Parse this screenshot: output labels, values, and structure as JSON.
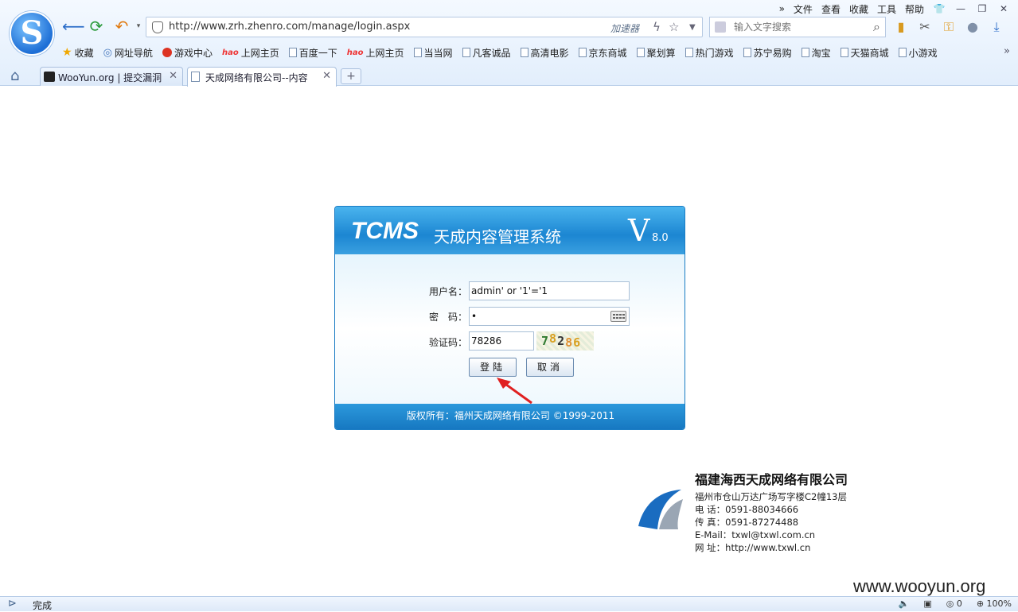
{
  "browser": {
    "menu": [
      "文件",
      "查看",
      "收藏",
      "工具",
      "帮助"
    ],
    "address_url": "http://www.zrh.zhenro.com/manage/login.aspx",
    "accelerator_label": "加速器",
    "search_placeholder": "输入文字搜索",
    "bookmarks": [
      "收藏",
      "网址导航",
      "游戏中心",
      "上网主页",
      "百度一下",
      "上网主页",
      "当当网",
      "凡客诚品",
      "高清电影",
      "京东商城",
      "聚划算",
      "热门游戏",
      "苏宁易购",
      "淘宝",
      "天猫商城",
      "小游戏"
    ],
    "tabs": [
      {
        "label": "WooYun.org | 提交漏洞"
      },
      {
        "label": "天成网络有限公司--内容"
      }
    ]
  },
  "login": {
    "brand": "TCMS",
    "system_name": "天成内容管理系统",
    "version_letter": "V",
    "version_number": "8.0",
    "username_label": "用户名：",
    "username_value": "admin' or '1'='1",
    "password_label": "密　码：",
    "password_value": "•",
    "captcha_label": "验证码：",
    "captcha_value": "78286",
    "captcha_digits": [
      "7",
      "8",
      "2",
      "8",
      "6"
    ],
    "login_button": "登陆",
    "cancel_button": "取消",
    "copyright": "版权所有：福州天成网络有限公司  ©1999-2011"
  },
  "company": {
    "name": "福建海西天成网络有限公司",
    "address": "福州市仓山万达广场写字楼C2幢13层",
    "phone": "电  话：0591-88034666",
    "fax": "传  真：0591-87274488",
    "email": "E-Mail：txwl@txwl.com.cn",
    "website": "网  址：http://www.txwl.cn"
  },
  "status": {
    "text": "完成",
    "counter": "0",
    "zoom": "100%"
  },
  "watermark": "www.wooyun.org",
  "colors": {
    "panel_header": "#1c86d2",
    "arrow": "#e02020"
  }
}
